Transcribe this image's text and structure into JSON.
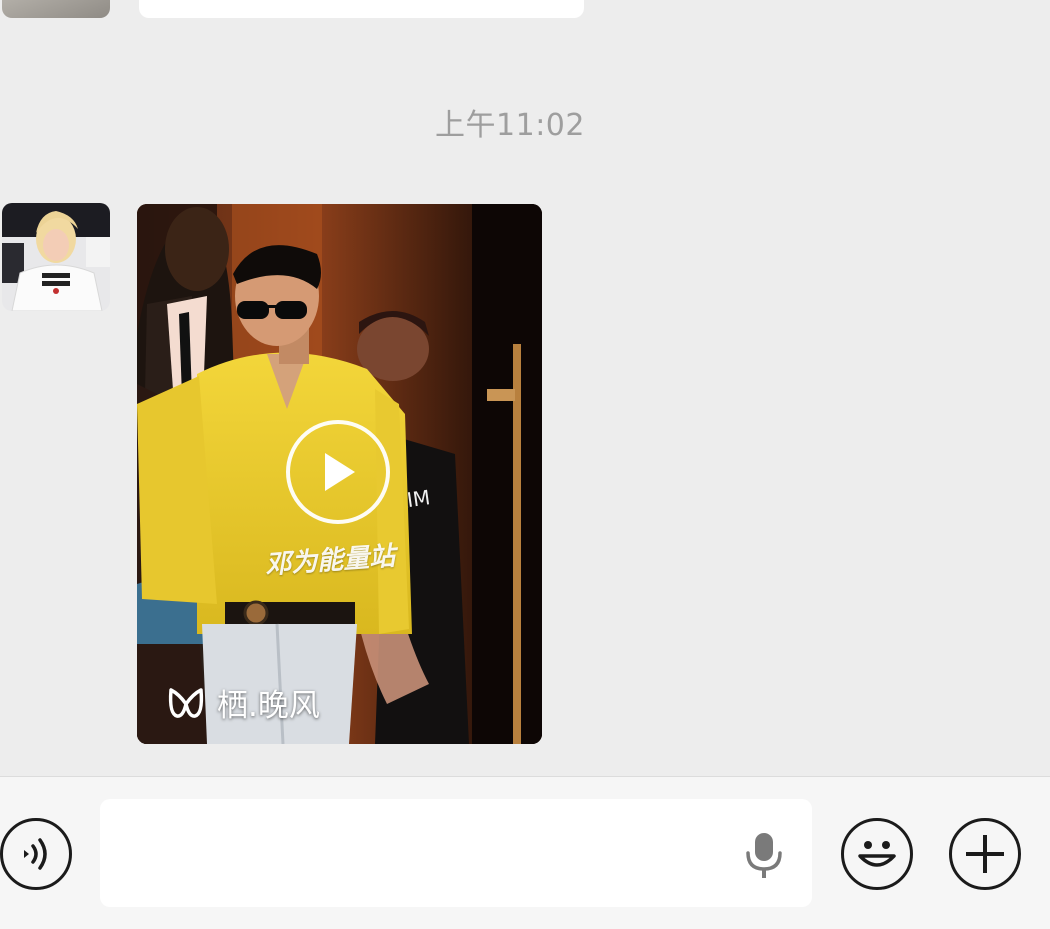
{
  "chat": {
    "timestamp": "上午11:02",
    "message": {
      "type": "video",
      "watermark": "邓为能量站",
      "channel_name": "栖.晚风",
      "channel_icon": "channels-icon",
      "play_icon": "play-icon"
    }
  },
  "input_bar": {
    "text_value": "",
    "voice_icon": "voice-mode-icon",
    "mic_icon": "microphone-icon",
    "emoji_icon": "emoji-icon",
    "more_icon": "plus-icon"
  },
  "colors": {
    "background": "#ededed",
    "input_bar_bg": "#f6f6f6",
    "timestamp_text": "#9e9e9e"
  }
}
